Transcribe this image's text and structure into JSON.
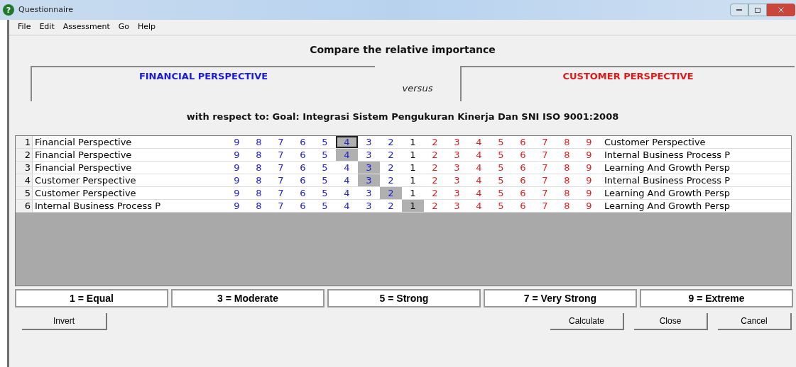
{
  "window": {
    "title": "Questionnaire",
    "icon": "?"
  },
  "menu": [
    "File",
    "Edit",
    "Assessment",
    "Go",
    "Help"
  ],
  "heading": "Compare the relative importance",
  "left_item": "FINANCIAL PERSPECTIVE",
  "versus": "versus",
  "right_item": "CUSTOMER PERSPECTIVE",
  "respect": "with respect to: Goal: Integrasi Sistem Pengukuran Kinerja Dan SNI ISO 9001:2008",
  "rows": [
    {
      "number": "1",
      "left": "Financial Perspective",
      "right": "Customer Perspective",
      "focused": true,
      "cells": [
        {
          "text": "9",
          "kind": "left",
          "selected": false
        },
        {
          "text": "8",
          "kind": "left",
          "selected": false
        },
        {
          "text": "7",
          "kind": "left",
          "selected": false
        },
        {
          "text": "6",
          "kind": "left",
          "selected": false
        },
        {
          "text": "5",
          "kind": "left",
          "selected": false
        },
        {
          "text": "4",
          "kind": "left",
          "selected": true
        },
        {
          "text": "3",
          "kind": "left",
          "selected": false
        },
        {
          "text": "2",
          "kind": "left",
          "selected": false
        },
        {
          "text": "1",
          "kind": "equal",
          "selected": false
        },
        {
          "text": "2",
          "kind": "right",
          "selected": false
        },
        {
          "text": "3",
          "kind": "right",
          "selected": false
        },
        {
          "text": "4",
          "kind": "right",
          "selected": false
        },
        {
          "text": "5",
          "kind": "right",
          "selected": false
        },
        {
          "text": "6",
          "kind": "right",
          "selected": false
        },
        {
          "text": "7",
          "kind": "right",
          "selected": false
        },
        {
          "text": "8",
          "kind": "right",
          "selected": false
        },
        {
          "text": "9",
          "kind": "right",
          "selected": false
        }
      ]
    },
    {
      "number": "2",
      "left": "Financial Perspective",
      "right": "Internal Business Process P",
      "focused": false,
      "cells": [
        {
          "text": "9",
          "kind": "left",
          "selected": false
        },
        {
          "text": "8",
          "kind": "left",
          "selected": false
        },
        {
          "text": "7",
          "kind": "left",
          "selected": false
        },
        {
          "text": "6",
          "kind": "left",
          "selected": false
        },
        {
          "text": "5",
          "kind": "left",
          "selected": false
        },
        {
          "text": "4",
          "kind": "left",
          "selected": true
        },
        {
          "text": "3",
          "kind": "left",
          "selected": false
        },
        {
          "text": "2",
          "kind": "left",
          "selected": false
        },
        {
          "text": "1",
          "kind": "equal",
          "selected": false
        },
        {
          "text": "2",
          "kind": "right",
          "selected": false
        },
        {
          "text": "3",
          "kind": "right",
          "selected": false
        },
        {
          "text": "4",
          "kind": "right",
          "selected": false
        },
        {
          "text": "5",
          "kind": "right",
          "selected": false
        },
        {
          "text": "6",
          "kind": "right",
          "selected": false
        },
        {
          "text": "7",
          "kind": "right",
          "selected": false
        },
        {
          "text": "8",
          "kind": "right",
          "selected": false
        },
        {
          "text": "9",
          "kind": "right",
          "selected": false
        }
      ]
    },
    {
      "number": "3",
      "left": "Financial Perspective",
      "right": "Learning And Growth Persp",
      "focused": false,
      "cells": [
        {
          "text": "9",
          "kind": "left",
          "selected": false
        },
        {
          "text": "8",
          "kind": "left",
          "selected": false
        },
        {
          "text": "7",
          "kind": "left",
          "selected": false
        },
        {
          "text": "6",
          "kind": "left",
          "selected": false
        },
        {
          "text": "5",
          "kind": "left",
          "selected": false
        },
        {
          "text": "4",
          "kind": "left",
          "selected": false
        },
        {
          "text": "3",
          "kind": "left",
          "selected": true
        },
        {
          "text": "2",
          "kind": "left",
          "selected": false
        },
        {
          "text": "1",
          "kind": "equal",
          "selected": false
        },
        {
          "text": "2",
          "kind": "right",
          "selected": false
        },
        {
          "text": "3",
          "kind": "right",
          "selected": false
        },
        {
          "text": "4",
          "kind": "right",
          "selected": false
        },
        {
          "text": "5",
          "kind": "right",
          "selected": false
        },
        {
          "text": "6",
          "kind": "right",
          "selected": false
        },
        {
          "text": "7",
          "kind": "right",
          "selected": false
        },
        {
          "text": "8",
          "kind": "right",
          "selected": false
        },
        {
          "text": "9",
          "kind": "right",
          "selected": false
        }
      ]
    },
    {
      "number": "4",
      "left": "Customer Perspective",
      "right": "Internal Business Process P",
      "focused": false,
      "cells": [
        {
          "text": "9",
          "kind": "left",
          "selected": false
        },
        {
          "text": "8",
          "kind": "left",
          "selected": false
        },
        {
          "text": "7",
          "kind": "left",
          "selected": false
        },
        {
          "text": "6",
          "kind": "left",
          "selected": false
        },
        {
          "text": "5",
          "kind": "left",
          "selected": false
        },
        {
          "text": "4",
          "kind": "left",
          "selected": false
        },
        {
          "text": "3",
          "kind": "left",
          "selected": true
        },
        {
          "text": "2",
          "kind": "left",
          "selected": false
        },
        {
          "text": "1",
          "kind": "equal",
          "selected": false
        },
        {
          "text": "2",
          "kind": "right",
          "selected": false
        },
        {
          "text": "3",
          "kind": "right",
          "selected": false
        },
        {
          "text": "4",
          "kind": "right",
          "selected": false
        },
        {
          "text": "5",
          "kind": "right",
          "selected": false
        },
        {
          "text": "6",
          "kind": "right",
          "selected": false
        },
        {
          "text": "7",
          "kind": "right",
          "selected": false
        },
        {
          "text": "8",
          "kind": "right",
          "selected": false
        },
        {
          "text": "9",
          "kind": "right",
          "selected": false
        }
      ]
    },
    {
      "number": "5",
      "left": "Customer Perspective",
      "right": "Learning And Growth Persp",
      "focused": false,
      "cells": [
        {
          "text": "9",
          "kind": "left",
          "selected": false
        },
        {
          "text": "8",
          "kind": "left",
          "selected": false
        },
        {
          "text": "7",
          "kind": "left",
          "selected": false
        },
        {
          "text": "6",
          "kind": "left",
          "selected": false
        },
        {
          "text": "5",
          "kind": "left",
          "selected": false
        },
        {
          "text": "4",
          "kind": "left",
          "selected": false
        },
        {
          "text": "3",
          "kind": "left",
          "selected": false
        },
        {
          "text": "2",
          "kind": "left",
          "selected": true
        },
        {
          "text": "1",
          "kind": "equal",
          "selected": false
        },
        {
          "text": "2",
          "kind": "right",
          "selected": false
        },
        {
          "text": "3",
          "kind": "right",
          "selected": false
        },
        {
          "text": "4",
          "kind": "right",
          "selected": false
        },
        {
          "text": "5",
          "kind": "right",
          "selected": false
        },
        {
          "text": "6",
          "kind": "right",
          "selected": false
        },
        {
          "text": "7",
          "kind": "right",
          "selected": false
        },
        {
          "text": "8",
          "kind": "right",
          "selected": false
        },
        {
          "text": "9",
          "kind": "right",
          "selected": false
        }
      ]
    },
    {
      "number": "6",
      "left": "Internal Business Process P",
      "right": "Learning And Growth Persp",
      "focused": false,
      "cells": [
        {
          "text": "9",
          "kind": "left",
          "selected": false
        },
        {
          "text": "8",
          "kind": "left",
          "selected": false
        },
        {
          "text": "7",
          "kind": "left",
          "selected": false
        },
        {
          "text": "6",
          "kind": "left",
          "selected": false
        },
        {
          "text": "5",
          "kind": "left",
          "selected": false
        },
        {
          "text": "4",
          "kind": "left",
          "selected": false
        },
        {
          "text": "3",
          "kind": "left",
          "selected": false
        },
        {
          "text": "2",
          "kind": "left",
          "selected": false
        },
        {
          "text": "1",
          "kind": "equal",
          "selected": true
        },
        {
          "text": "2",
          "kind": "right",
          "selected": false
        },
        {
          "text": "3",
          "kind": "right",
          "selected": false
        },
        {
          "text": "4",
          "kind": "right",
          "selected": false
        },
        {
          "text": "5",
          "kind": "right",
          "selected": false
        },
        {
          "text": "6",
          "kind": "right",
          "selected": false
        },
        {
          "text": "7",
          "kind": "right",
          "selected": false
        },
        {
          "text": "8",
          "kind": "right",
          "selected": false
        },
        {
          "text": "9",
          "kind": "right",
          "selected": false
        }
      ]
    }
  ],
  "legend": [
    "1 = Equal",
    "3 = Moderate",
    "5 = Strong",
    "7 = Very Strong",
    "9 = Extreme"
  ],
  "buttons_left": [
    "Invert"
  ],
  "buttons_right": [
    "Calculate",
    "Close",
    "Cancel"
  ]
}
